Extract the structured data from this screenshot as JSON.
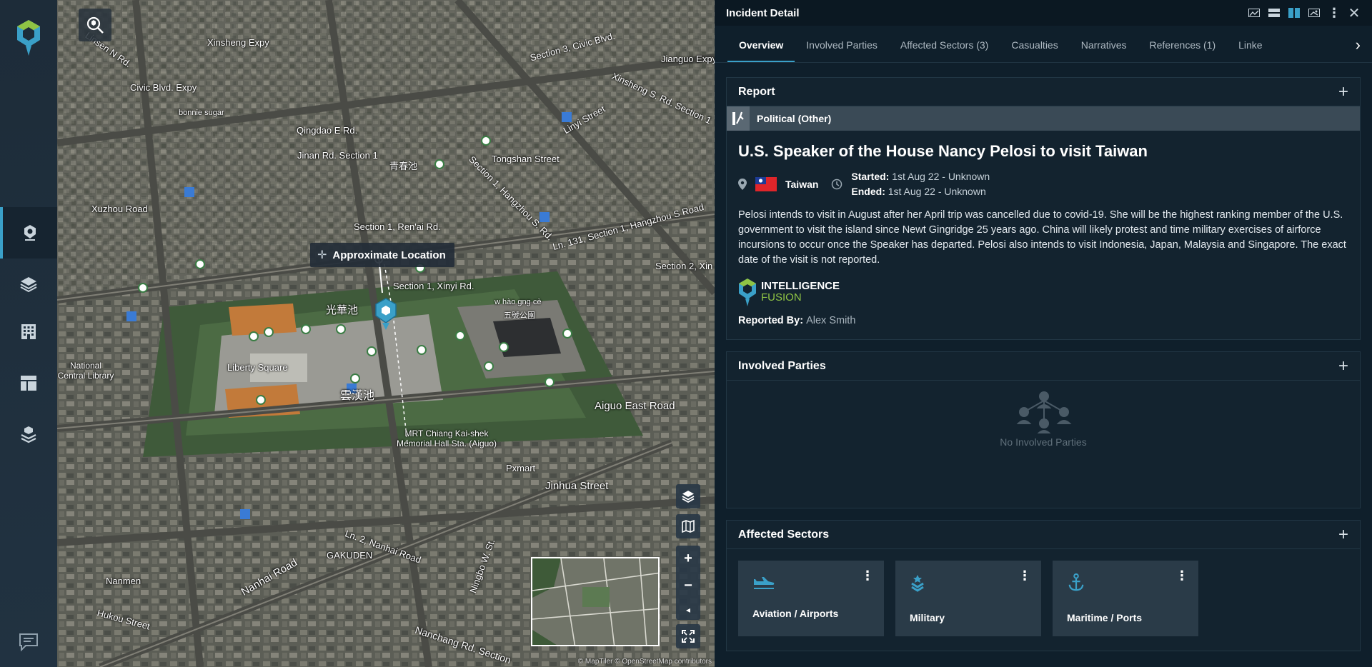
{
  "map": {
    "approx_label": "Approximate Location",
    "attribution": "© MapTiler © OpenStreetMap contributors",
    "labels": [
      "Xinsheng Expy",
      "Civic Blvd. Expy",
      "Linsen N Rd.",
      "Qingdao E Rd.",
      "Jinan Rd. Section 1",
      "Xuzhou Road",
      "Section 1, Ren'ai Rd.",
      "Section 1, Xinyi Rd.",
      "Liberty Square",
      "National Central Library",
      "Aiguo East Road",
      "Jinhua Street",
      "Nanhai Road",
      "Ln. 2, Nanhai Road",
      "Hukou Street",
      "Nanmen",
      "GAKUDEN",
      "Pxmart",
      "MRT Chiang Kai-shek Memorial Hall Sta. (Aiguo)",
      "Nanchang Rd. Section",
      "Ningbo W. St.",
      "Linyi Street",
      "Section 1, Hangzhou S. Rd.",
      "Section 3, Civic Blvd.",
      "Jianguo Expy",
      "Xinsheng S. Rd. Section 1",
      "Ln. 131, Section 1, Hangzhou S Road",
      "Section 2, Xin",
      "bonnie sugar",
      "Tongshan Street",
      "雲漢池",
      "光華池",
      "青春池",
      "w hào gng cè",
      "五號公園"
    ]
  },
  "rail": {
    "items": [
      "location",
      "layers",
      "buildings",
      "dashboard",
      "stack"
    ]
  },
  "panel": {
    "title": "Incident Detail",
    "tabs": [
      "Overview",
      "Involved Parties",
      "Affected Sectors (3)",
      "Casualties",
      "Narratives",
      "References (1)",
      "Linke"
    ],
    "report": {
      "heading": "Report",
      "category": "Political (Other)",
      "title": "U.S. Speaker of the House Nancy Pelosi to visit Taiwan",
      "country": "Taiwan",
      "started_label": "Started:",
      "started_value": "1st Aug 22 - Unknown",
      "ended_label": "Ended:",
      "ended_value": "1st Aug 22 - Unknown",
      "description": "Pelosi intends to visit in August after her April trip was cancelled due to covid-19. She will be the highest ranking member of the U.S. government to visit the island since Newt Gingridge 25 years ago. China will likely protest and time military exercises of airforce incursions to occur once the Speaker has departed. Pelosi also intends to visit Indonesia, Japan, Malaysia and Singapore. The exact date of the visit is not reported.",
      "brand_line1": "INTELLIGENCE",
      "brand_line2": "FUSION",
      "reported_label": "Reported By:",
      "reported_value": "Alex Smith"
    },
    "involved": {
      "heading": "Involved Parties",
      "empty": "No Involved Parties"
    },
    "sectors": {
      "heading": "Affected Sectors",
      "items": [
        {
          "label": "Aviation / Airports",
          "icon": "plane-icon"
        },
        {
          "label": "Military",
          "icon": "military-rank-icon"
        },
        {
          "label": "Maritime / Ports",
          "icon": "anchor-icon"
        }
      ]
    }
  },
  "colors": {
    "accent": "#3aa0c8",
    "logo_green": "#8fc444"
  }
}
